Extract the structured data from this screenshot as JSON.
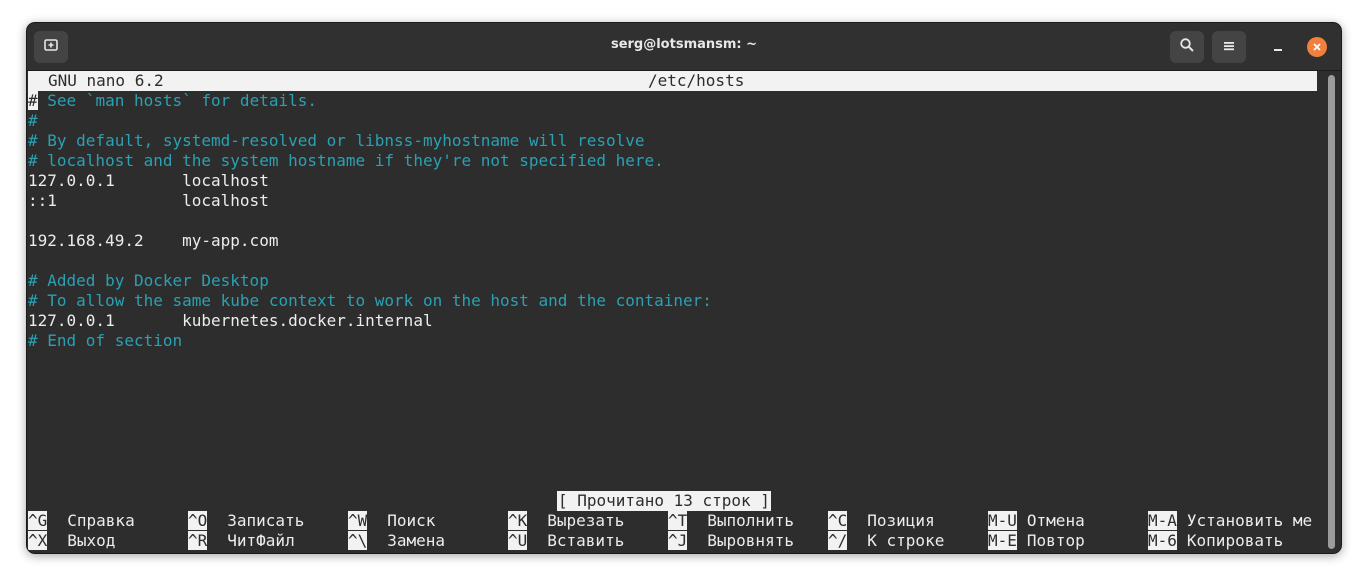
{
  "window": {
    "title": "serg@lotsmansm: ~"
  },
  "nano": {
    "version": "GNU nano 6.2",
    "filename": "/etc/hosts",
    "cursor_char": "#",
    "lines": [
      {
        "text": " See `man hosts` for details.",
        "comment": true,
        "cursor": true
      },
      {
        "text": "#",
        "comment": true
      },
      {
        "text": "# By default, systemd-resolved or libnss-myhostname will resolve",
        "comment": true
      },
      {
        "text": "# localhost and the system hostname if they're not specified here.",
        "comment": true
      },
      {
        "text": "127.0.0.1       localhost",
        "comment": false
      },
      {
        "text": "::1             localhost",
        "comment": false
      },
      {
        "text": "",
        "comment": false
      },
      {
        "text": "192.168.49.2    my-app.com",
        "comment": false
      },
      {
        "text": "",
        "comment": false
      },
      {
        "text": "# Added by Docker Desktop",
        "comment": true
      },
      {
        "text": "# To allow the same kube context to work on the host and the container:",
        "comment": true
      },
      {
        "text": "127.0.0.1       kubernetes.docker.internal",
        "comment": false
      },
      {
        "text": "# End of section",
        "comment": true
      }
    ],
    "status_message": "[ Прочитано 13 строк ]",
    "shortcuts_row1": [
      {
        "key": "^G",
        "label": "Справка"
      },
      {
        "key": "^O",
        "label": "Записать"
      },
      {
        "key": "^W",
        "label": "Поиск"
      },
      {
        "key": "^K",
        "label": "Вырезать"
      },
      {
        "key": "^T",
        "label": "Выполнить"
      },
      {
        "key": "^C",
        "label": "Позиция"
      },
      {
        "key": "M-U",
        "label": "Отмена"
      },
      {
        "key": "M-A",
        "label": "Установить ме"
      }
    ],
    "shortcuts_row2": [
      {
        "key": "^X",
        "label": "Выход"
      },
      {
        "key": "^R",
        "label": "ЧитФайл"
      },
      {
        "key": "^\\",
        "label": "Замена"
      },
      {
        "key": "^U",
        "label": "Вставить"
      },
      {
        "key": "^J",
        "label": "Выровнять"
      },
      {
        "key": "^/",
        "label": "К строке"
      },
      {
        "key": "M-E",
        "label": "Повтор"
      },
      {
        "key": "M-6",
        "label": "Копировать"
      }
    ]
  },
  "icons": {
    "new_tab": "new-tab-icon",
    "search": "search-icon",
    "menu": "hamburger-menu-icon",
    "minimize": "minimize-icon",
    "close": "close-icon"
  },
  "colors": {
    "terminal_bg": "#2d2d2d",
    "comment": "#2aa1b3",
    "text": "#ececec",
    "close_button": "#f0803c"
  }
}
